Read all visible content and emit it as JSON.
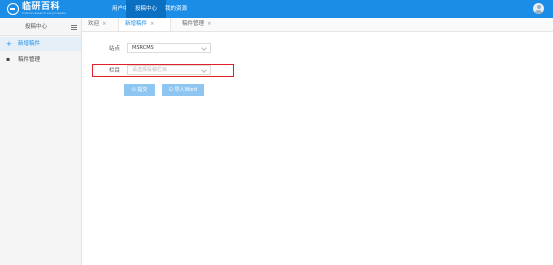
{
  "brand": {
    "name": "临研百科",
    "tagline": "Clinical research encyclopedia"
  },
  "topnav": {
    "items": [
      "用户中心",
      "投稿中心",
      "我的资源"
    ],
    "active_index": 1
  },
  "sidebar": {
    "header": "投稿中心",
    "items": [
      {
        "label": "新增稿件",
        "icon": "plus-icon"
      },
      {
        "label": "稿件管理",
        "icon": "document-icon"
      }
    ],
    "active_index": 0
  },
  "tabs": [
    {
      "label": "欢迎"
    },
    {
      "label": "新增稿件"
    },
    {
      "label": "稿件管理"
    }
  ],
  "form": {
    "source_label": "站点",
    "source_value": "MSRCMS",
    "column_label": "栏目",
    "column_placeholder": "请选择投稿栏目",
    "submit_label": "提交",
    "import_label": "导入Word"
  },
  "colors": {
    "primary": "#1c8de6",
    "highlight": "#e0202a",
    "button": "#8ec6f2"
  }
}
